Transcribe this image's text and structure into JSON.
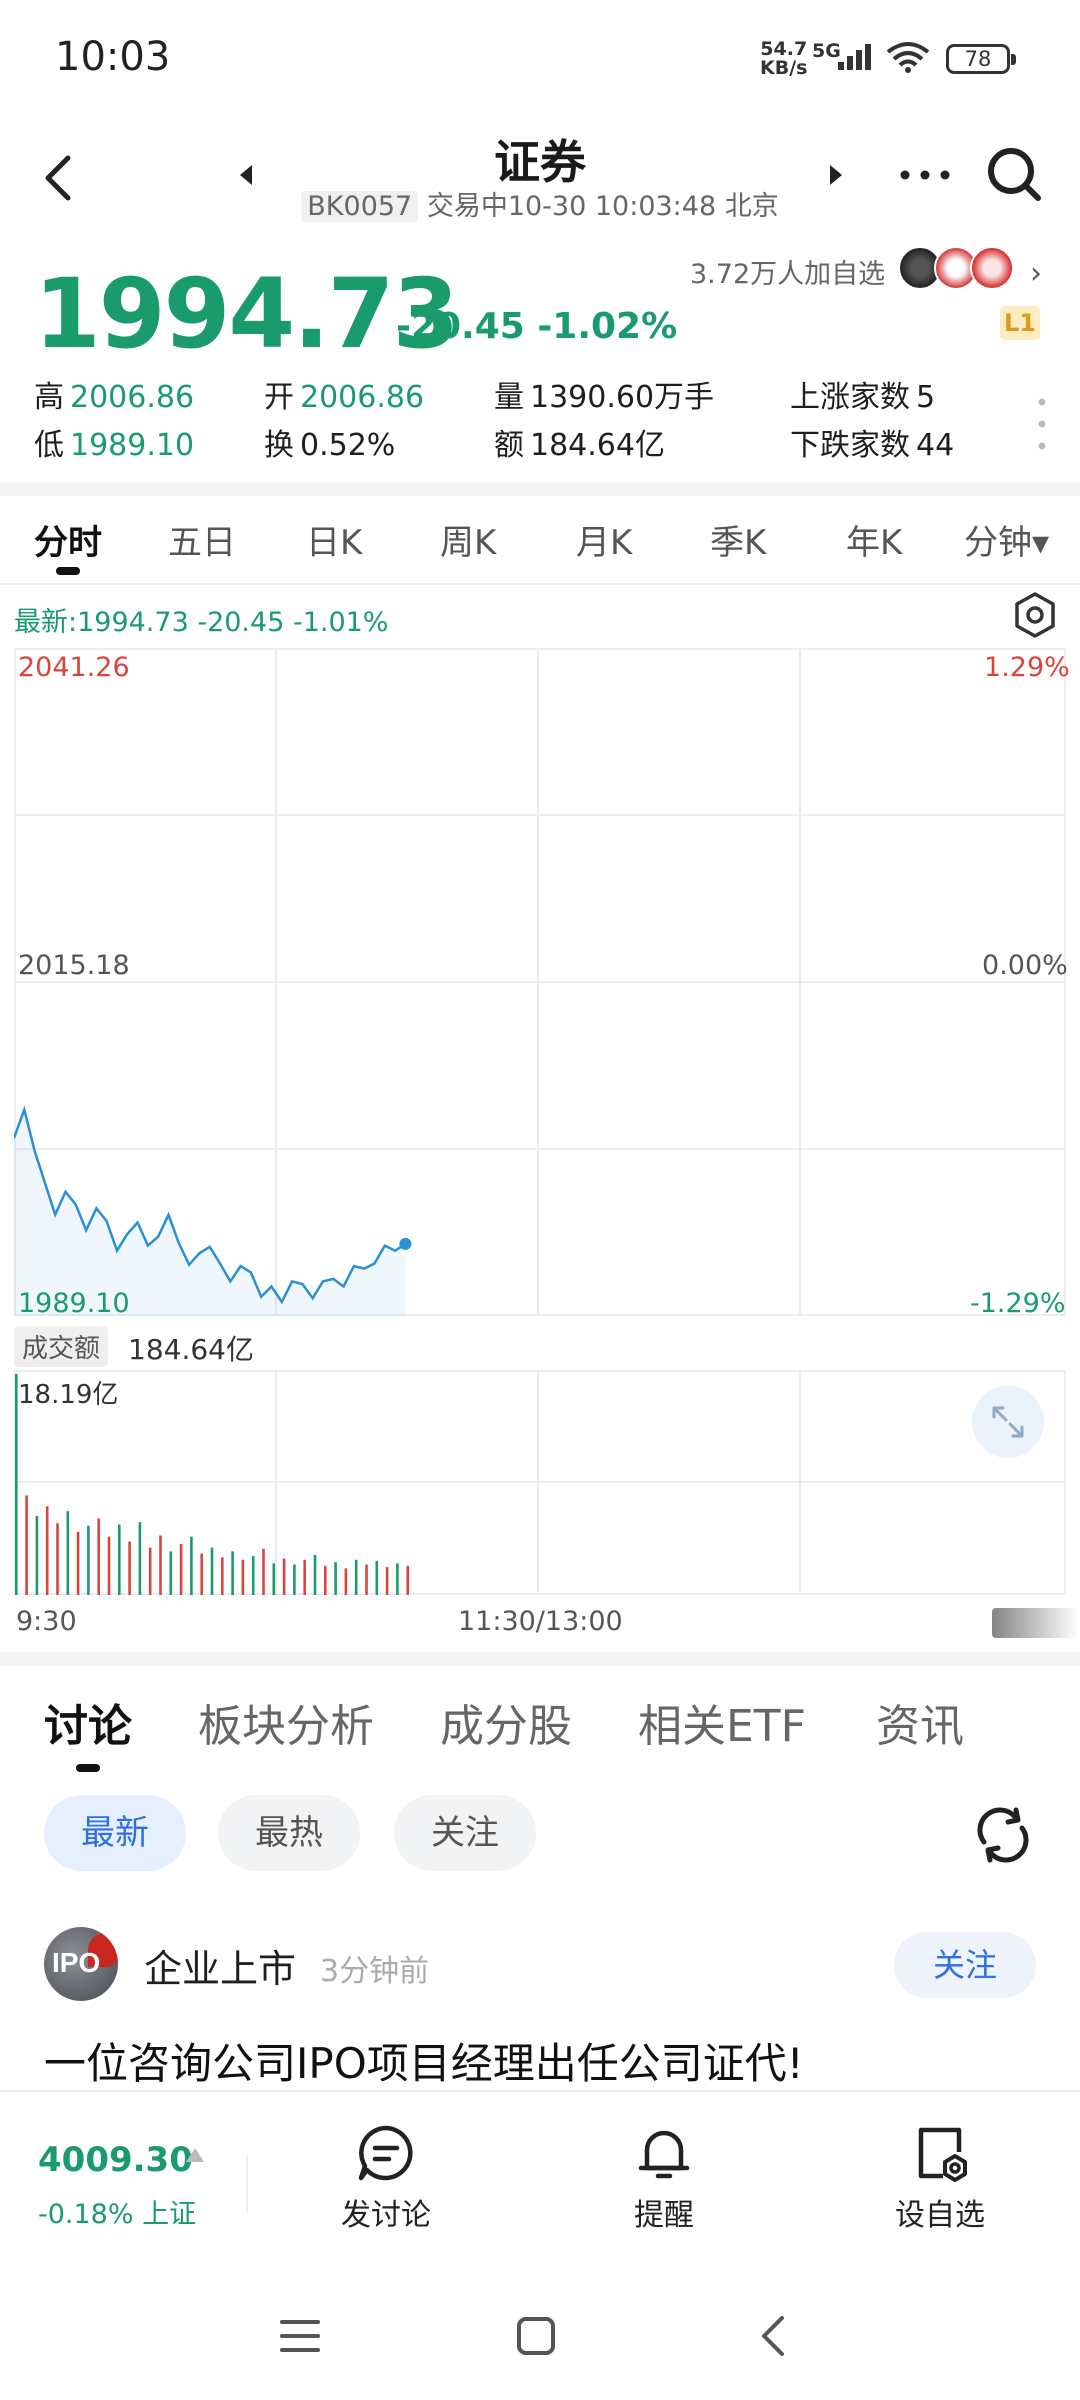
{
  "status_bar": {
    "time": "10:03",
    "net_speed_value": "54.7",
    "net_speed_unit": "KB/s",
    "network_type": "5G",
    "battery": "78"
  },
  "header": {
    "title": "证券",
    "code": "BK0057",
    "status_line": "交易中10-30 10:03:48 北京"
  },
  "quote": {
    "price": "1994.73",
    "change": "-20.45 -1.02%",
    "followers": "3.72万人加自选",
    "level_badge": "L1",
    "stats": {
      "high_label": "高",
      "high": "2006.86",
      "open_label": "开",
      "open": "2006.86",
      "volume_label": "量",
      "volume": "1390.60万手",
      "up_count_label": "上涨家数",
      "up_count": "5",
      "low_label": "低",
      "low": "1989.10",
      "turnover_label": "换",
      "turnover": "0.52%",
      "amount_label": "额",
      "amount": "184.64亿",
      "down_count_label": "下跌家数",
      "down_count": "44"
    }
  },
  "chart_tabs": [
    "分时",
    "五日",
    "日K",
    "周K",
    "月K",
    "季K",
    "年K",
    "分钟▾"
  ],
  "chart_tabs_active": 0,
  "chart": {
    "latest_line": "最新:1994.73  -20.45  -1.01%",
    "y_max": "2041.26",
    "y_mid": "2015.18",
    "y_min": "1989.10",
    "pct_max": "1.29%",
    "pct_mid": "0.00%",
    "pct_min": "-1.29%",
    "volume_label": "成交额",
    "volume_value": "184.64亿",
    "volume_max": "18.19亿",
    "time_start": "9:30",
    "time_mid": "11:30/13:00"
  },
  "chart_data": {
    "type": "line",
    "ylim": [
      1989.1,
      2041.26
    ],
    "x_range_minutes": 240,
    "prices": [
      2003.0,
      2005.2,
      2002.0,
      1999.5,
      1997.0,
      1998.8,
      1997.8,
      1995.8,
      1997.5,
      1996.5,
      1994.2,
      1995.5,
      1996.4,
      1994.6,
      1995.3,
      1997.0,
      1994.8,
      1993.1,
      1994.0,
      1994.5,
      1993.2,
      1991.8,
      1993.0,
      1992.5,
      1990.6,
      1991.4,
      1990.2,
      1991.8,
      1991.6,
      1990.5,
      1991.8,
      1992.0,
      1991.4,
      1993.0,
      1992.8,
      1993.2,
      1994.6,
      1994.2,
      1994.73
    ],
    "volume_max": 18.19,
    "volumes": [
      18.19,
      8.2,
      6.5,
      7.3,
      5.9,
      6.9,
      5.2,
      5.7,
      6.3,
      4.8,
      5.8,
      4.4,
      6.0,
      3.9,
      4.9,
      3.6,
      4.2,
      4.8,
      3.4,
      3.9,
      3.1,
      3.6,
      2.9,
      3.2,
      3.8,
      2.6,
      3.0,
      2.5,
      2.9,
      3.3,
      2.4,
      2.7,
      2.2,
      2.9,
      2.5,
      2.8,
      2.3,
      2.6,
      2.4
    ],
    "volume_colors": [
      "g",
      "r",
      "g",
      "r",
      "r",
      "g",
      "r",
      "g",
      "r",
      "r",
      "g",
      "r",
      "g",
      "r",
      "r",
      "g",
      "r",
      "g",
      "r",
      "g",
      "r",
      "g",
      "r",
      "g",
      "r",
      "g",
      "r",
      "g",
      "r",
      "g",
      "r",
      "g",
      "r",
      "g",
      "r",
      "g",
      "r",
      "g",
      "r"
    ]
  },
  "content_tabs": [
    "讨论",
    "板块分析",
    "成分股",
    "相关ETF",
    "资讯"
  ],
  "content_tabs_active": 0,
  "filters": [
    "最新",
    "最热",
    "关注"
  ],
  "filters_active": 0,
  "post": {
    "avatar_text": "IPO",
    "author": "企业上市",
    "time": "3分钟前",
    "follow_label": "关注",
    "title": "一位咨询公司IPO项目经理出任公司证代!"
  },
  "bottom_bar": {
    "index_value": "4009.30",
    "index_change": "-0.18% 上证",
    "discuss_label": "发讨论",
    "remind_label": "提醒",
    "watchlist_label": "设自选"
  },
  "colors": {
    "down": "#1a9b6c",
    "up": "#d9453c",
    "line": "#2b8fd6",
    "accent": "#2f6fe0"
  },
  "icons": [
    "back-icon",
    "prev-arrow-icon",
    "next-arrow-icon",
    "more-icon",
    "search-icon",
    "chart-settings-icon",
    "expand-icon",
    "refresh-icon",
    "discuss-icon",
    "bell-icon",
    "watchlist-icon",
    "menu-icon",
    "home-icon",
    "nav-back-icon"
  ]
}
